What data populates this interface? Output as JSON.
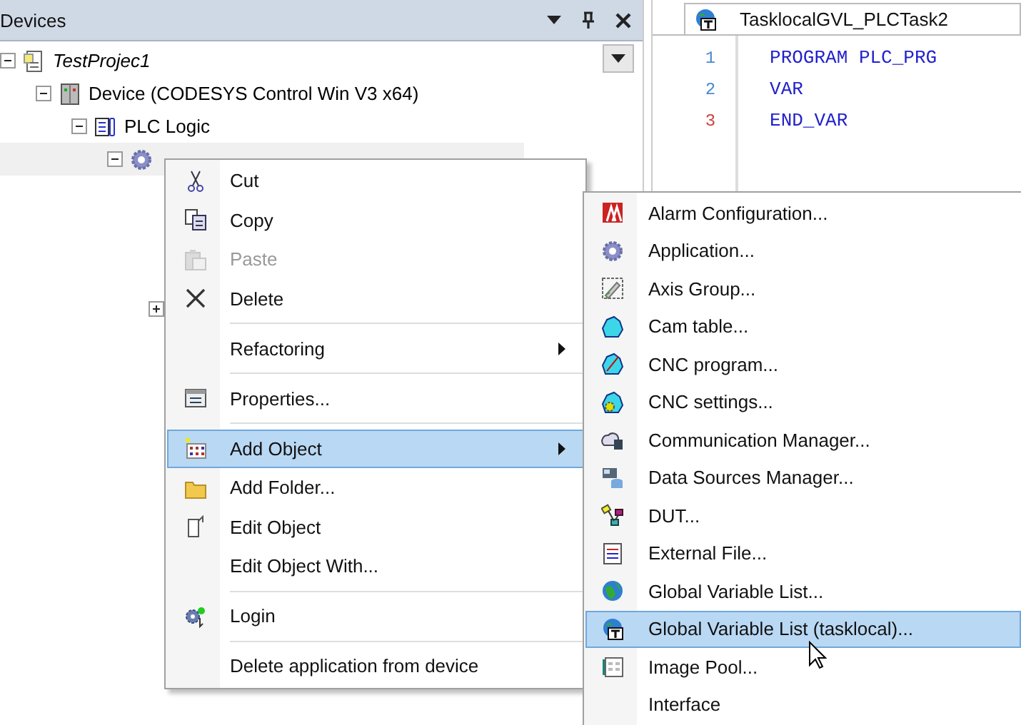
{
  "devices_panel": {
    "title": "Devices",
    "tree": [
      {
        "label": "TestProjec1",
        "expanded": true,
        "children": [
          {
            "label": "Device (CODESYS Control Win V3 x64)",
            "expanded": true,
            "children": [
              {
                "label": "PLC Logic",
                "expanded": true,
                "children": [
                  {
                    "expanded": true,
                    "children": [
                      {
                        "expanded": false
                      }
                    ]
                  }
                ]
              }
            ]
          }
        ]
      }
    ]
  },
  "editor": {
    "tab": {
      "label": "TasklocalGVL_PLCTask2",
      "selected": true
    },
    "lines": [
      {
        "number": "1",
        "color": "#4a8ad0",
        "code": "PROGRAM PLC_PRG"
      },
      {
        "number": "2",
        "color": "#4a8ad0",
        "code": "VAR"
      },
      {
        "number": "3",
        "color": "#d04040",
        "code": "END_VAR"
      }
    ]
  },
  "context_menu": [
    {
      "kind": "item",
      "label": "Cut",
      "disabled": false,
      "selected": false,
      "submenu": false
    },
    {
      "kind": "item",
      "label": "Copy",
      "disabled": false,
      "selected": false,
      "submenu": false
    },
    {
      "kind": "item",
      "label": "Paste",
      "disabled": true,
      "selected": false,
      "submenu": false
    },
    {
      "kind": "item",
      "label": "Delete",
      "disabled": false,
      "selected": false,
      "submenu": false
    },
    {
      "kind": "separator"
    },
    {
      "kind": "item",
      "label": "Refactoring",
      "disabled": false,
      "selected": false,
      "submenu": true
    },
    {
      "kind": "separator"
    },
    {
      "kind": "item",
      "label": "Properties...",
      "disabled": false,
      "selected": false,
      "submenu": false
    },
    {
      "kind": "separator"
    },
    {
      "kind": "item",
      "label": "Add Object",
      "disabled": false,
      "selected": true,
      "submenu": true
    },
    {
      "kind": "item",
      "label": "Add Folder...",
      "disabled": false,
      "selected": false,
      "submenu": false
    },
    {
      "kind": "item",
      "label": "Edit Object",
      "disabled": false,
      "selected": false,
      "submenu": false
    },
    {
      "kind": "item",
      "label": "Edit Object With...",
      "disabled": false,
      "selected": false,
      "submenu": false
    },
    {
      "kind": "separator"
    },
    {
      "kind": "item",
      "label": "Login",
      "disabled": false,
      "selected": false,
      "submenu": false
    },
    {
      "kind": "separator"
    },
    {
      "kind": "item",
      "label": "Delete application from device",
      "disabled": false,
      "selected": false,
      "submenu": false
    }
  ],
  "add_object_submenu": [
    {
      "label": "Alarm Configuration...",
      "selected": false
    },
    {
      "label": "Application...",
      "selected": false
    },
    {
      "label": "Axis Group...",
      "selected": false
    },
    {
      "label": "Cam table...",
      "selected": false
    },
    {
      "label": "CNC program...",
      "selected": false
    },
    {
      "label": "CNC settings...",
      "selected": false
    },
    {
      "label": "Communication Manager...",
      "selected": false
    },
    {
      "label": "Data Sources Manager...",
      "selected": false
    },
    {
      "label": "DUT...",
      "selected": false
    },
    {
      "label": "External File...",
      "selected": false
    },
    {
      "label": "Global Variable List...",
      "selected": false
    },
    {
      "label": "Global Variable List (tasklocal)...",
      "selected": true
    },
    {
      "label": "Image Pool...",
      "selected": false
    },
    {
      "label": "Interface",
      "selected": false
    }
  ]
}
